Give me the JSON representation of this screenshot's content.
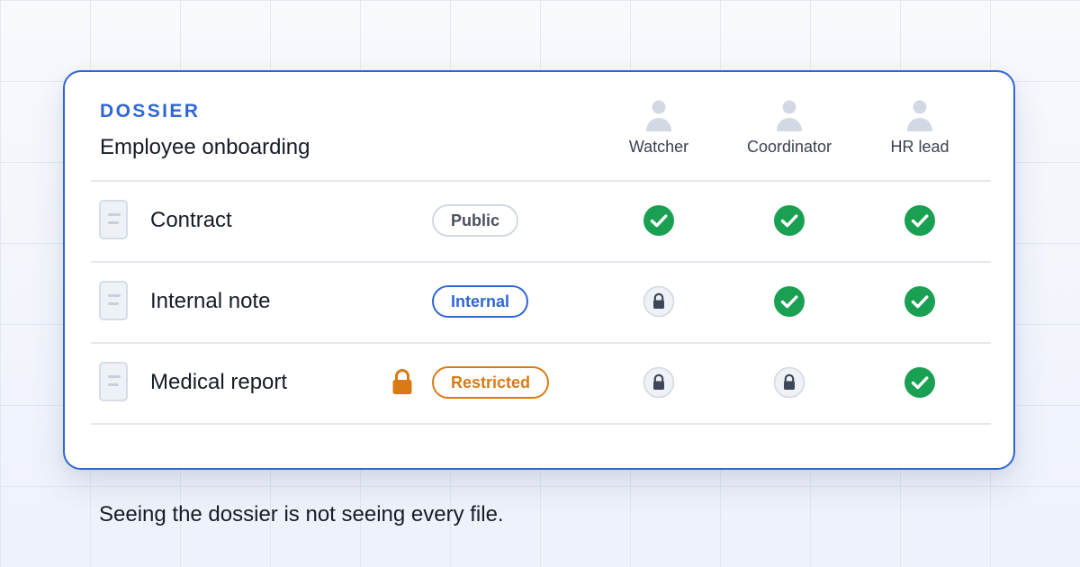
{
  "card": {
    "eyebrow": "DOSSIER",
    "title": "Employee onboarding",
    "accent_color": "#2f66d6"
  },
  "roles": [
    {
      "label": "Watcher",
      "icon": "user-icon"
    },
    {
      "label": "Coordinator",
      "icon": "user-icon"
    },
    {
      "label": "HR lead",
      "icon": "user-icon"
    }
  ],
  "rows": [
    {
      "name": "Contract",
      "icon": "document-icon",
      "badge": "Public",
      "badge_kind": "public",
      "restricted_lock": false,
      "access": [
        "granted",
        "granted",
        "granted"
      ]
    },
    {
      "name": "Internal note",
      "icon": "document-icon",
      "badge": "Internal",
      "badge_kind": "internal",
      "restricted_lock": false,
      "access": [
        "locked",
        "granted",
        "granted"
      ]
    },
    {
      "name": "Medical report",
      "icon": "document-icon",
      "badge": "Restricted",
      "badge_kind": "restricted",
      "restricted_lock": true,
      "access": [
        "locked",
        "locked",
        "granted"
      ]
    }
  ],
  "colors": {
    "granted": "#1aa052",
    "locked_bg": "#eef1f6",
    "locked_fg": "#3e4657",
    "restricted": "#d97a14",
    "internal": "#2f66d6"
  },
  "caption": "Seeing the dossier is not seeing every file."
}
